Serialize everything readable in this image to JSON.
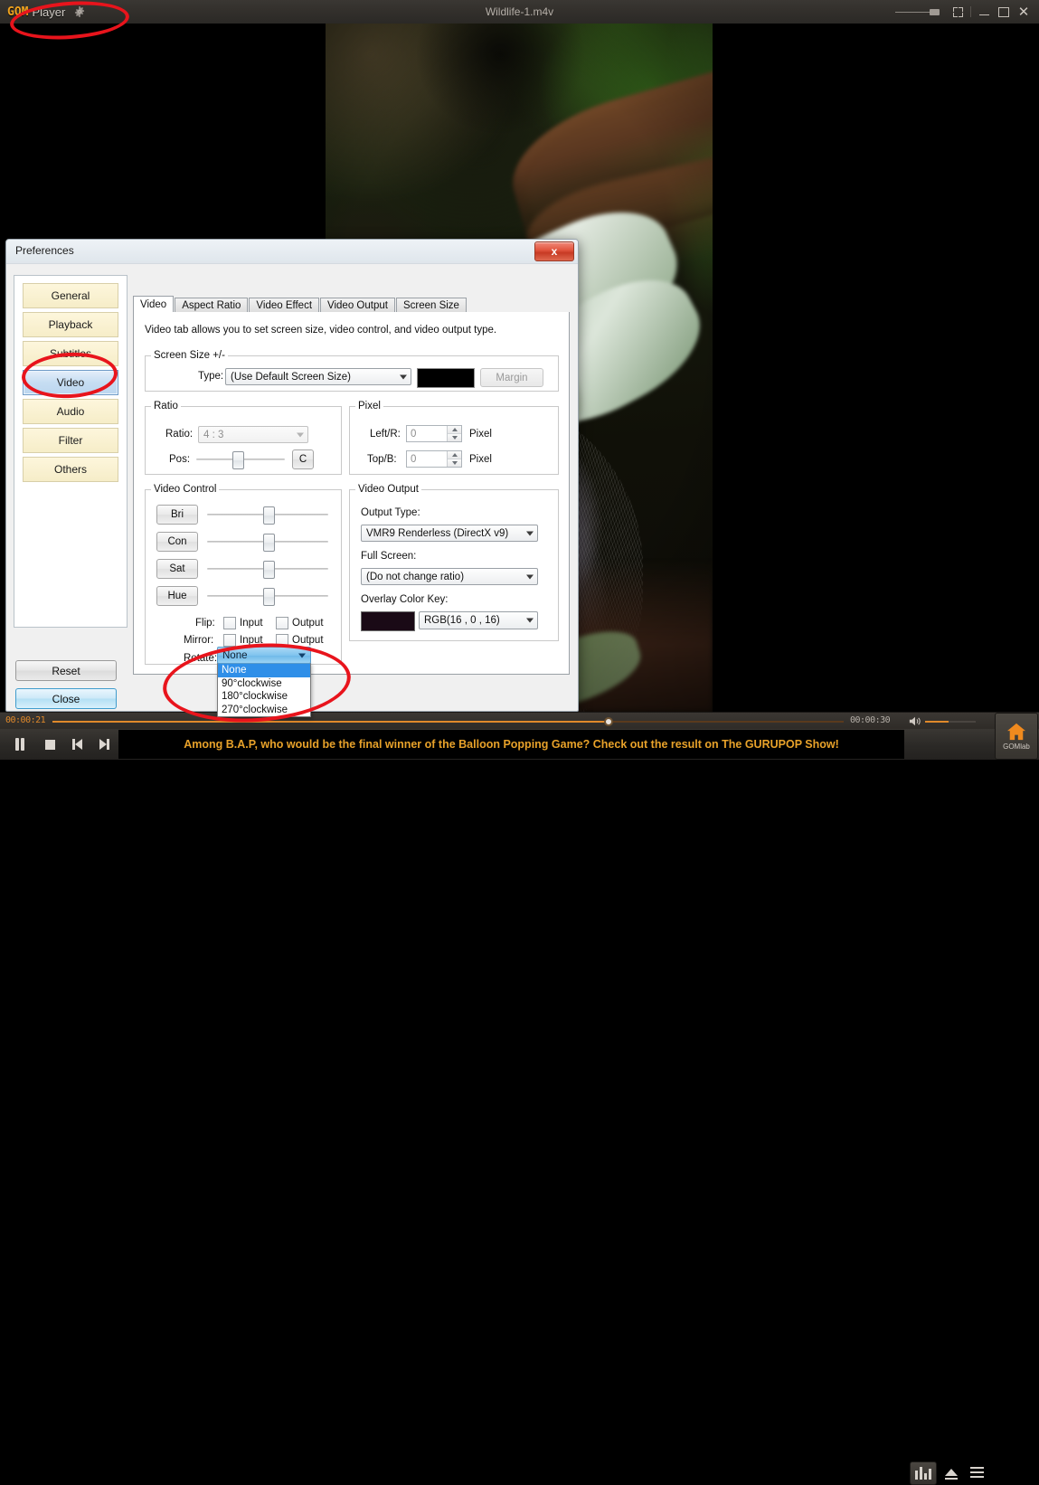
{
  "titlebar": {
    "brand_gom": "GOM",
    "brand_player": "Player",
    "gear_icon": "gear-icon",
    "title": "Wildlife-1.m4v",
    "buttons": {
      "fullscreen": "fullscreen-icon",
      "minimize": "minimize-icon",
      "maximize": "maximize-icon",
      "close": "✕"
    }
  },
  "dialog": {
    "title": "Preferences",
    "close_label": "x",
    "sidebar": {
      "items": [
        {
          "label": "General",
          "selected": false
        },
        {
          "label": "Playback",
          "selected": false
        },
        {
          "label": "Subtitles",
          "selected": false
        },
        {
          "label": "Video",
          "selected": true
        },
        {
          "label": "Audio",
          "selected": false
        },
        {
          "label": "Filter",
          "selected": false
        },
        {
          "label": "Others",
          "selected": false
        }
      ]
    },
    "footer": {
      "reset_label": "Reset",
      "close_label": "Close"
    },
    "tabs": [
      {
        "label": "Video",
        "active": true
      },
      {
        "label": "Aspect Ratio",
        "active": false
      },
      {
        "label": "Video Effect",
        "active": false
      },
      {
        "label": "Video Output",
        "active": false
      },
      {
        "label": "Screen Size",
        "active": false
      }
    ],
    "pane": {
      "description": "Video tab allows you to set screen size, video control, and video output type.",
      "screen_size": {
        "legend": "Screen Size +/-",
        "type_label": "Type:",
        "type_value": "(Use Default Screen Size)",
        "swatch_color": "#000000",
        "margin_label": "Margin"
      },
      "ratio": {
        "legend": "Ratio",
        "ratio_label": "Ratio:",
        "ratio_value": "4 : 3",
        "pos_label": "Pos:",
        "center_label": "C"
      },
      "pixel": {
        "legend": "Pixel",
        "left_right_label": "Left/R:",
        "left_right_value": "0",
        "left_right_unit": "Pixel",
        "top_bottom_label": "Top/B:",
        "top_bottom_value": "0",
        "top_bottom_unit": "Pixel"
      },
      "video_control": {
        "legend": "Video Control",
        "sliders": [
          {
            "label": "Bri",
            "position_pct": 50
          },
          {
            "label": "Con",
            "position_pct": 50
          },
          {
            "label": "Sat",
            "position_pct": 50
          },
          {
            "label": "Hue",
            "position_pct": 50
          }
        ],
        "flip_label": "Flip:",
        "mirror_label": "Mirror:",
        "rotate_label": "Rotate:",
        "input_label": "Input",
        "output_label": "Output",
        "flip_input_checked": false,
        "flip_output_checked": false,
        "mirror_input_checked": false,
        "mirror_output_checked": false,
        "rotate_value": "None",
        "rotate_options": [
          {
            "label": "None",
            "selected": true
          },
          {
            "label": "90°clockwise",
            "selected": false
          },
          {
            "label": "180°clockwise",
            "selected": false
          },
          {
            "label": "270°clockwise",
            "selected": false
          }
        ]
      },
      "video_output": {
        "legend": "Video Output",
        "output_type_label": "Output Type:",
        "output_type_value": "VMR9 Renderless (DirectX v9)",
        "full_screen_label": "Full Screen:",
        "full_screen_value": "(Do not change ratio)",
        "overlay_color_key_label": "Overlay Color Key:",
        "overlay_swatch_color": "#1a0a16",
        "overlay_color_value": "RGB(16 , 0 , 16)"
      }
    }
  },
  "player": {
    "time_current": "00:00:21",
    "time_total": "00:00:30",
    "seek_pct": 70,
    "volume_pct": 46,
    "controls": {
      "pause": "pause-icon",
      "stop": "stop-icon",
      "previous": "previous-track-icon",
      "next": "next-track-icon",
      "equalizer": "equalizer-icon",
      "eject": "eject-icon",
      "menu": "menu-icon"
    },
    "marquee_text": "Among B.A.P, who would be the final winner of the Balloon Popping Game? Check out the result on The GURUPOP Show!",
    "gomlab": {
      "icon": "home-icon",
      "label": "GOMlab"
    }
  },
  "annotations": {
    "accent_color": "#e8141c",
    "marks": [
      "logo-highlight",
      "video-sidebar-highlight",
      "rotate-dropdown-highlight"
    ]
  }
}
